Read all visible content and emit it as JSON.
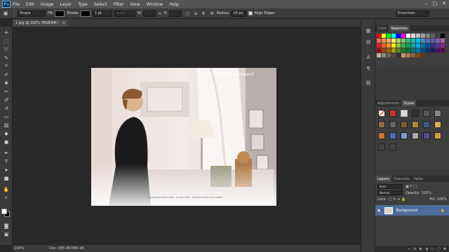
{
  "menubar": {
    "logo": "Ps",
    "items": [
      "File",
      "Edit",
      "Image",
      "Layer",
      "Type",
      "Select",
      "Filter",
      "View",
      "Window",
      "Help"
    ]
  },
  "options": {
    "mode": "Shape",
    "fill_label": "Fill:",
    "stroke_label": "Stroke:",
    "stroke_width": "1 pt",
    "w_label": "W:",
    "h_label": "H:",
    "radius_label": "Radius:",
    "radius_value": "10 px",
    "align_edges": "Align Edges",
    "workspace": "Essentials"
  },
  "document": {
    "tab_title": "1.jpg @ 100% (RGB/8#)",
    "watermark": "VIXX Entertainment",
    "caption": "FOR PROMOTIONAL ONLY · DO NOT EDIT · TAKE OUT WITH FULL CREDIT"
  },
  "status": {
    "zoom": "100%",
    "doc": "Doc: 585.9K/585.9K"
  },
  "panels": {
    "color_tab": "Color",
    "swatches_tab": "Swatches",
    "adjustments_tab": "Adjustments",
    "styles_tab": "Styles",
    "layers_tab": "Layers",
    "channels_tab": "Channels",
    "paths_tab": "Paths",
    "kind": "Kind",
    "blend_mode": "Normal",
    "opacity_label": "Opacity:",
    "opacity_value": "100%",
    "lock_label": "Lock:",
    "fill_label": "Fill:",
    "fill_value": "100%",
    "layer_name": "Background"
  }
}
